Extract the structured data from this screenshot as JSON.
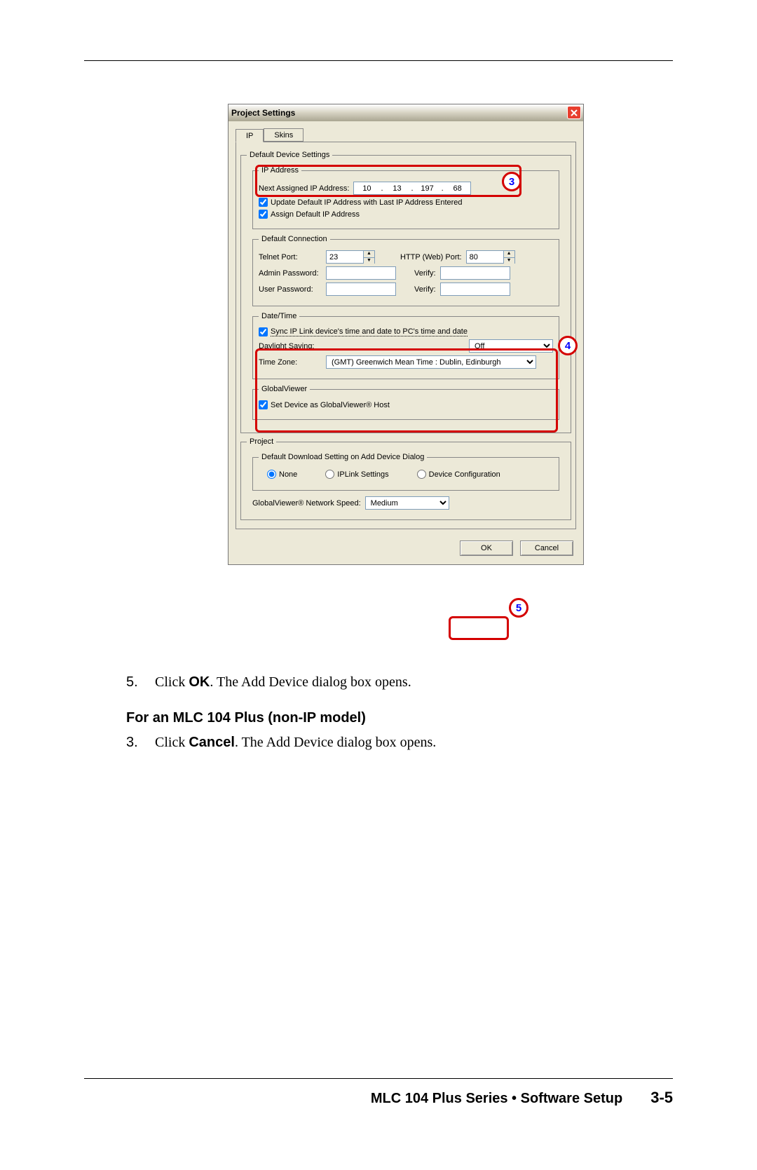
{
  "dialog": {
    "title": "Project Settings",
    "tabs": {
      "ip": "IP",
      "skins": "Skins"
    },
    "groups": {
      "defaultDevice": "Default Device Settings",
      "ipAddress": "IP Address",
      "nextAssigned": "Next Assigned IP Address:",
      "ip": {
        "a": "10",
        "b": "13",
        "c": "197",
        "d": "68"
      },
      "updateDefault": "Update Default IP Address with Last IP Address Entered",
      "assignDefault": "Assign Default IP Address",
      "defaultConn": "Default Connection",
      "telnetPort": "Telnet Port:",
      "telnetValue": "23",
      "httpPort": "HTTP (Web) Port:",
      "httpValue": "80",
      "adminPass": "Admin Password:",
      "verify": "Verify:",
      "userPass": "User Password:",
      "dateTime": "Date/Time",
      "syncTime": "Sync IP Link device's time and date to PC's time and date",
      "daylight": "Daylight Saving:",
      "daylightVal": "Off",
      "timezone": "Time Zone:",
      "timezoneVal": "(GMT) Greenwich Mean Time : Dublin, Edinburgh",
      "globalViewer": "GlobalViewer",
      "setGV": "Set Device as GlobalViewer® Host",
      "project": "Project",
      "defaultDL": "Default Download Setting on Add Device Dialog",
      "none": "None",
      "ipLink": "IPLink Settings",
      "devConf": "Device Configuration",
      "gvNetSpeed": "GlobalViewer® Network Speed:",
      "gvNetSpeedVal": "Medium"
    },
    "buttons": {
      "ok": "OK",
      "cancel": "Cancel"
    }
  },
  "callouts": {
    "c3": "3",
    "c4": "4",
    "c5": "5"
  },
  "doc": {
    "step5num": "5.",
    "step5a": "Click ",
    "step5b": "OK",
    "step5c": ".  The Add Device dialog box opens.",
    "heading": "For an MLC 104 Plus (non-IP model)",
    "step3num": "3.",
    "step3a": "Click ",
    "step3b": "Cancel",
    "step3c": ".  The Add Device dialog box opens.",
    "footerTitle": "MLC 104 Plus Series • Software Setup",
    "pageNum": "3-5"
  }
}
